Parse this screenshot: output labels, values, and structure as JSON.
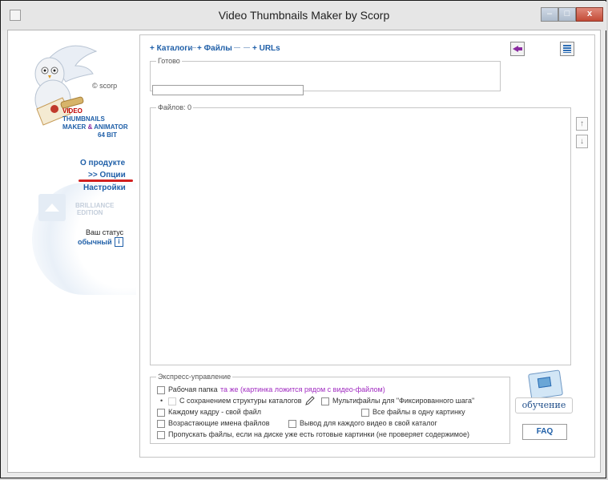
{
  "window": {
    "title": "Video Thumbnails Maker by Scorp",
    "min": "–",
    "max": "□",
    "close": "x"
  },
  "sidebar": {
    "copyright": "© scorp",
    "product_line1": "VIDEO",
    "product_line2": "THUMBNAILS",
    "product_line3a": "MAKER ",
    "product_line3b": "&",
    "product_line3c": " ANIMATOR",
    "product_line4": "64 BIT",
    "links": [
      "О продукте",
      ">> Опции",
      "Настройки"
    ],
    "edition_line1": "BRILLIANCE",
    "edition_line2": "EDITION",
    "status_label": "Ваш статус",
    "status_value": "обычный",
    "info_glyph": "i"
  },
  "toolbar": {
    "tabs": [
      "+ Каталоги",
      "+ Файлы",
      "+ URLs"
    ]
  },
  "main": {
    "ready_legend": "Готово",
    "files_legend": "Файлов: 0",
    "arrow_up": "↑",
    "arrow_down": "↓"
  },
  "express": {
    "legend": "Экспресс-управление",
    "work_folder": "Рабочая папка",
    "work_folder_value": "та же (картинка ложится рядом с видео-файлом)",
    "bullet": "•",
    "keep_structure": "С сохранением структуры каталогов",
    "multifiles": "Мультифайлы для \"Фиксированного шага\"",
    "each_frame": "Каждому кадру - свой файл",
    "all_one": "Все файлы в одну картинку",
    "ascending": "Возрастающие имена файлов",
    "own_dir": "Вывод для каждого видео в свой каталог",
    "skip": "Пропускать файлы, если на диске уже есть готовые картинки (не проверяет содержимое)"
  },
  "help": {
    "learn_label": "обучение",
    "faq_label": "FAQ"
  },
  "colors": {
    "accent": "#1f5fa8",
    "highlight": "#a02ac0",
    "underline": "#d22020"
  }
}
